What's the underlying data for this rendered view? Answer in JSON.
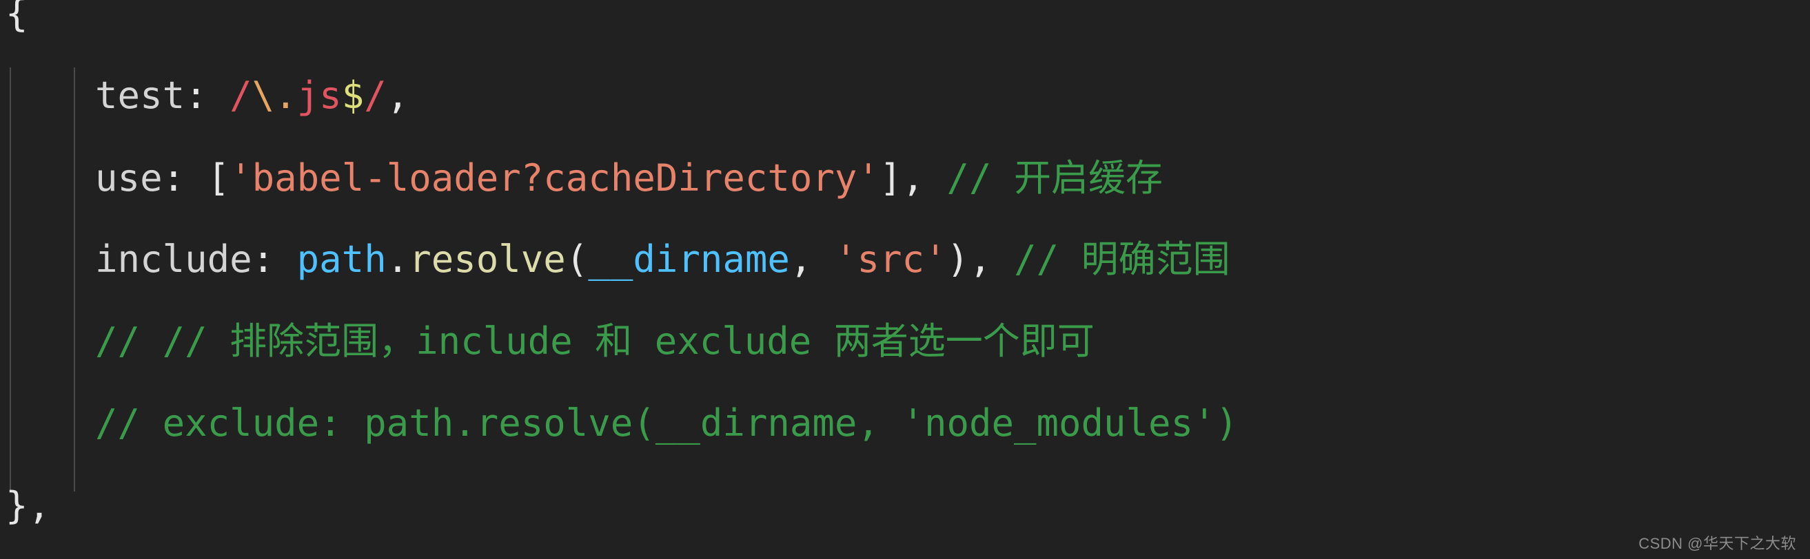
{
  "editor": {
    "background_color": "#212121",
    "indent_guide_color": "#4a4a4a",
    "language": "javascript",
    "colors": {
      "plain": "#d4d4d4",
      "punctuation": "#e6e6e6",
      "regex": "#e05561",
      "regex_escape": "#e5a663",
      "regex_anchor": "#dbe07a",
      "string": "#e8836b",
      "comment": "#3a9c4b",
      "function": "#dcdcaa",
      "variable": "#4fc1ff"
    }
  },
  "code": {
    "lines": [
      {
        "id": "line-open-brace",
        "indent": "",
        "segments": [
          {
            "text": "{",
            "token": "punct"
          }
        ]
      },
      {
        "id": "line-test",
        "indent": "    ",
        "segments": [
          {
            "text": "test",
            "token": "prop"
          },
          {
            "text": ": ",
            "token": "punct"
          },
          {
            "text": "/",
            "token": "regex"
          },
          {
            "text": "\\",
            "token": "regex-esc"
          },
          {
            "text": ".",
            "token": "regex-esc"
          },
          {
            "text": "js",
            "token": "regex"
          },
          {
            "text": "$",
            "token": "regex-anchor"
          },
          {
            "text": "/",
            "token": "regex"
          },
          {
            "text": ",",
            "token": "punct"
          }
        ]
      },
      {
        "id": "line-use",
        "indent": "    ",
        "segments": [
          {
            "text": "use",
            "token": "prop"
          },
          {
            "text": ": [",
            "token": "punct"
          },
          {
            "text": "'babel-loader?cacheDirectory'",
            "token": "string"
          },
          {
            "text": "], ",
            "token": "punct"
          },
          {
            "text": "// 开启缓存",
            "token": "comment"
          }
        ]
      },
      {
        "id": "line-include",
        "indent": "    ",
        "segments": [
          {
            "text": "include",
            "token": "prop"
          },
          {
            "text": ": ",
            "token": "punct"
          },
          {
            "text": "path",
            "token": "var"
          },
          {
            "text": ".",
            "token": "punct"
          },
          {
            "text": "resolve",
            "token": "func"
          },
          {
            "text": "(",
            "token": "punct"
          },
          {
            "text": "__dirname",
            "token": "var"
          },
          {
            "text": ", ",
            "token": "punct"
          },
          {
            "text": "'src'",
            "token": "string"
          },
          {
            "text": "), ",
            "token": "punct"
          },
          {
            "text": "// 明确范围",
            "token": "comment"
          }
        ]
      },
      {
        "id": "line-comment-exclude-note",
        "indent": "    ",
        "segments": [
          {
            "text": "// // 排除范围，include 和 exclude 两者选一个即可",
            "token": "comment"
          }
        ]
      },
      {
        "id": "line-comment-exclude-code",
        "indent": "    ",
        "segments": [
          {
            "text": "// exclude: path.resolve(__dirname, 'node_modules')",
            "token": "comment"
          }
        ]
      },
      {
        "id": "line-close-brace",
        "indent": "",
        "segments": [
          {
            "text": "},",
            "token": "punct"
          }
        ]
      }
    ]
  },
  "watermark": {
    "text": "CSDN @华天下之大软"
  }
}
